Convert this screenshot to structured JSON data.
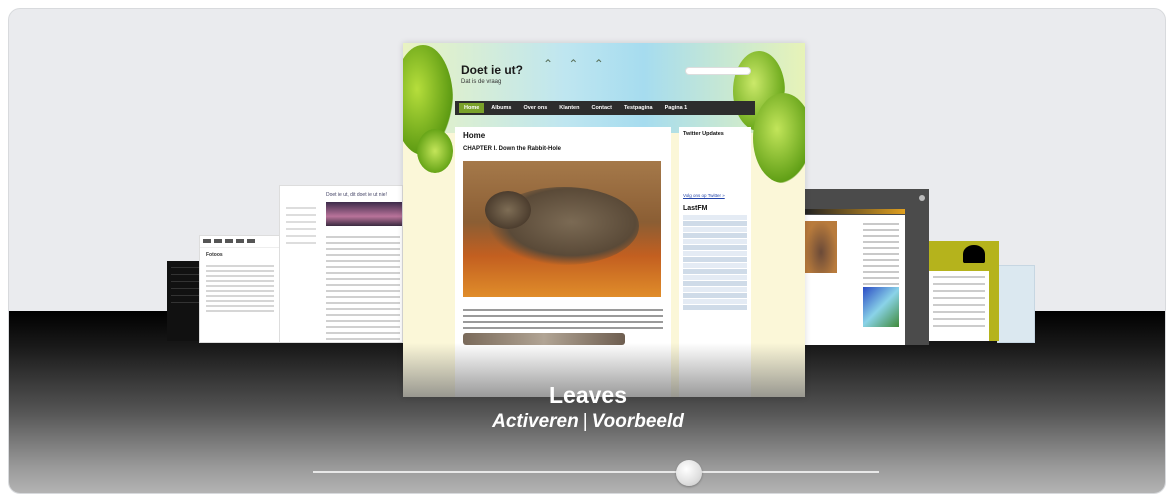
{
  "carousel": {
    "current_theme": "Leaves",
    "actions": {
      "activate_label": "Activeren",
      "separator": "|",
      "preview_label": "Voorbeeld"
    },
    "slider": {
      "position": 0.665
    }
  },
  "featured_preview": {
    "site_title": "Doet ie ut?",
    "tagline": "Dat is de vraag",
    "nav": [
      "Home",
      "Albums",
      "Over ons",
      "Klanten",
      "Contact",
      "Testpagina",
      "Pagina 1"
    ],
    "active_nav": "Home",
    "page_heading": "Home",
    "post_heading": "CHAPTER I. Down the Rabbit-Hole",
    "sidebar": {
      "twitter_heading": "Twitter Updates",
      "twitter_link": "Volg ons op Twitter »",
      "lastfm_heading": "LastFM"
    }
  },
  "side_preview": {
    "blog_title": "Doet ie ut, dit doet ie ut nie!",
    "white_title": "Fotoos"
  }
}
